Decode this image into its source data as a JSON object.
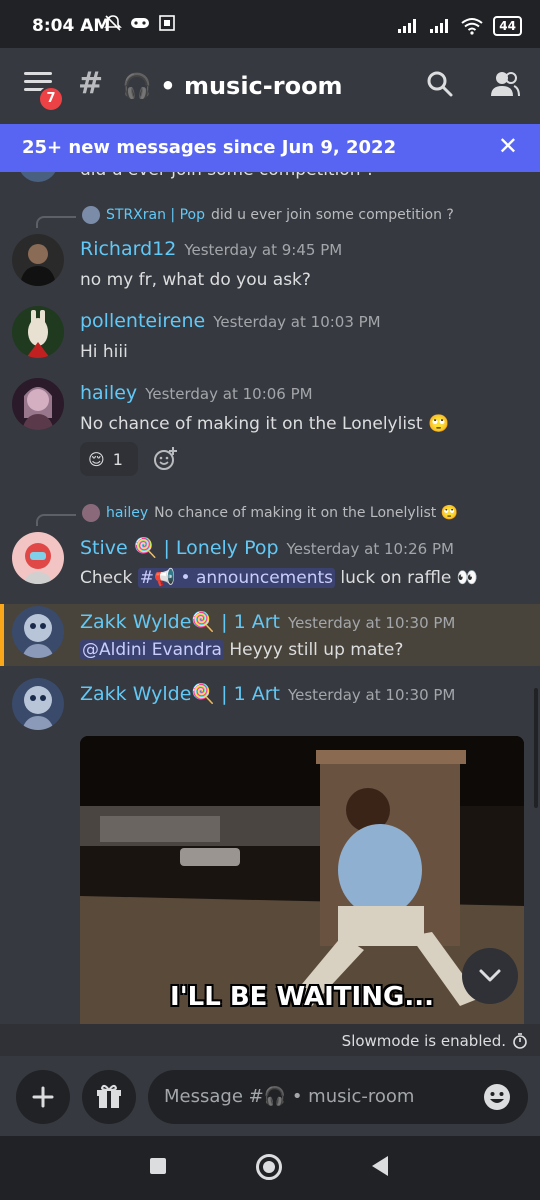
{
  "status_bar": {
    "time": "8:04 AM",
    "battery": "44",
    "left_icons": [
      "mute-icon",
      "game-icon",
      "calendar-icon"
    ],
    "right_icons": [
      "signal-icon",
      "signal-icon",
      "wifi-icon",
      "battery-icon"
    ]
  },
  "header": {
    "notification_count": "7",
    "channel_prefix": "#",
    "channel_emoji": "🎧",
    "channel_name": "• music-room"
  },
  "banner": {
    "text": "25+ new messages since Jun 9, 2022",
    "close_label": "✕"
  },
  "messages": {
    "partial_text": "did u ever join some competition ?",
    "richard": {
      "reply_to_name": "STRXran | Pop",
      "reply_to_text": "did u ever join some competition ?",
      "author": "Richard12",
      "timestamp": "Yesterday at 9:45 PM",
      "text": "no my fr, what do you ask?"
    },
    "pollen": {
      "author": "pollenteirene",
      "timestamp": "Yesterday at 10:03 PM",
      "text": "Hi hiii"
    },
    "hailey": {
      "author": "hailey",
      "timestamp": "Yesterday at 10:06 PM",
      "text": "No chance of making it on the Lonelylist 🙄",
      "reaction_emoji": "😌",
      "reaction_count": "1"
    },
    "stive": {
      "reply_to_name": "hailey",
      "reply_to_text": "No chance of making it on the Lonelylist 🙄",
      "author": "Stive 🍭 | Lonely Pop",
      "timestamp": "Yesterday at 10:26 PM",
      "text_before": "Check",
      "channel_mention": "#📢 • announcements",
      "text_after": "luck on raffle 👀"
    },
    "zakk1": {
      "author": "Zakk Wylde🍭 | 1 Art",
      "timestamp": "Yesterday at 10:30 PM",
      "mention": "@Aldini Evandra",
      "text": "Heyyy still up mate?"
    },
    "zakk2": {
      "author": "Zakk Wylde🍭 | 1 Art",
      "timestamp": "Yesterday at 10:30 PM",
      "gif_caption": "I'LL BE WAITING..."
    }
  },
  "slowmode": {
    "text": "Slowmode is enabled."
  },
  "composer": {
    "placeholder": "Message #🎧 • music-room"
  },
  "colors": {
    "accent": "#5865f2",
    "username": "#62c8f6",
    "highlight": "#faa81a",
    "badge": "#ed4245"
  }
}
